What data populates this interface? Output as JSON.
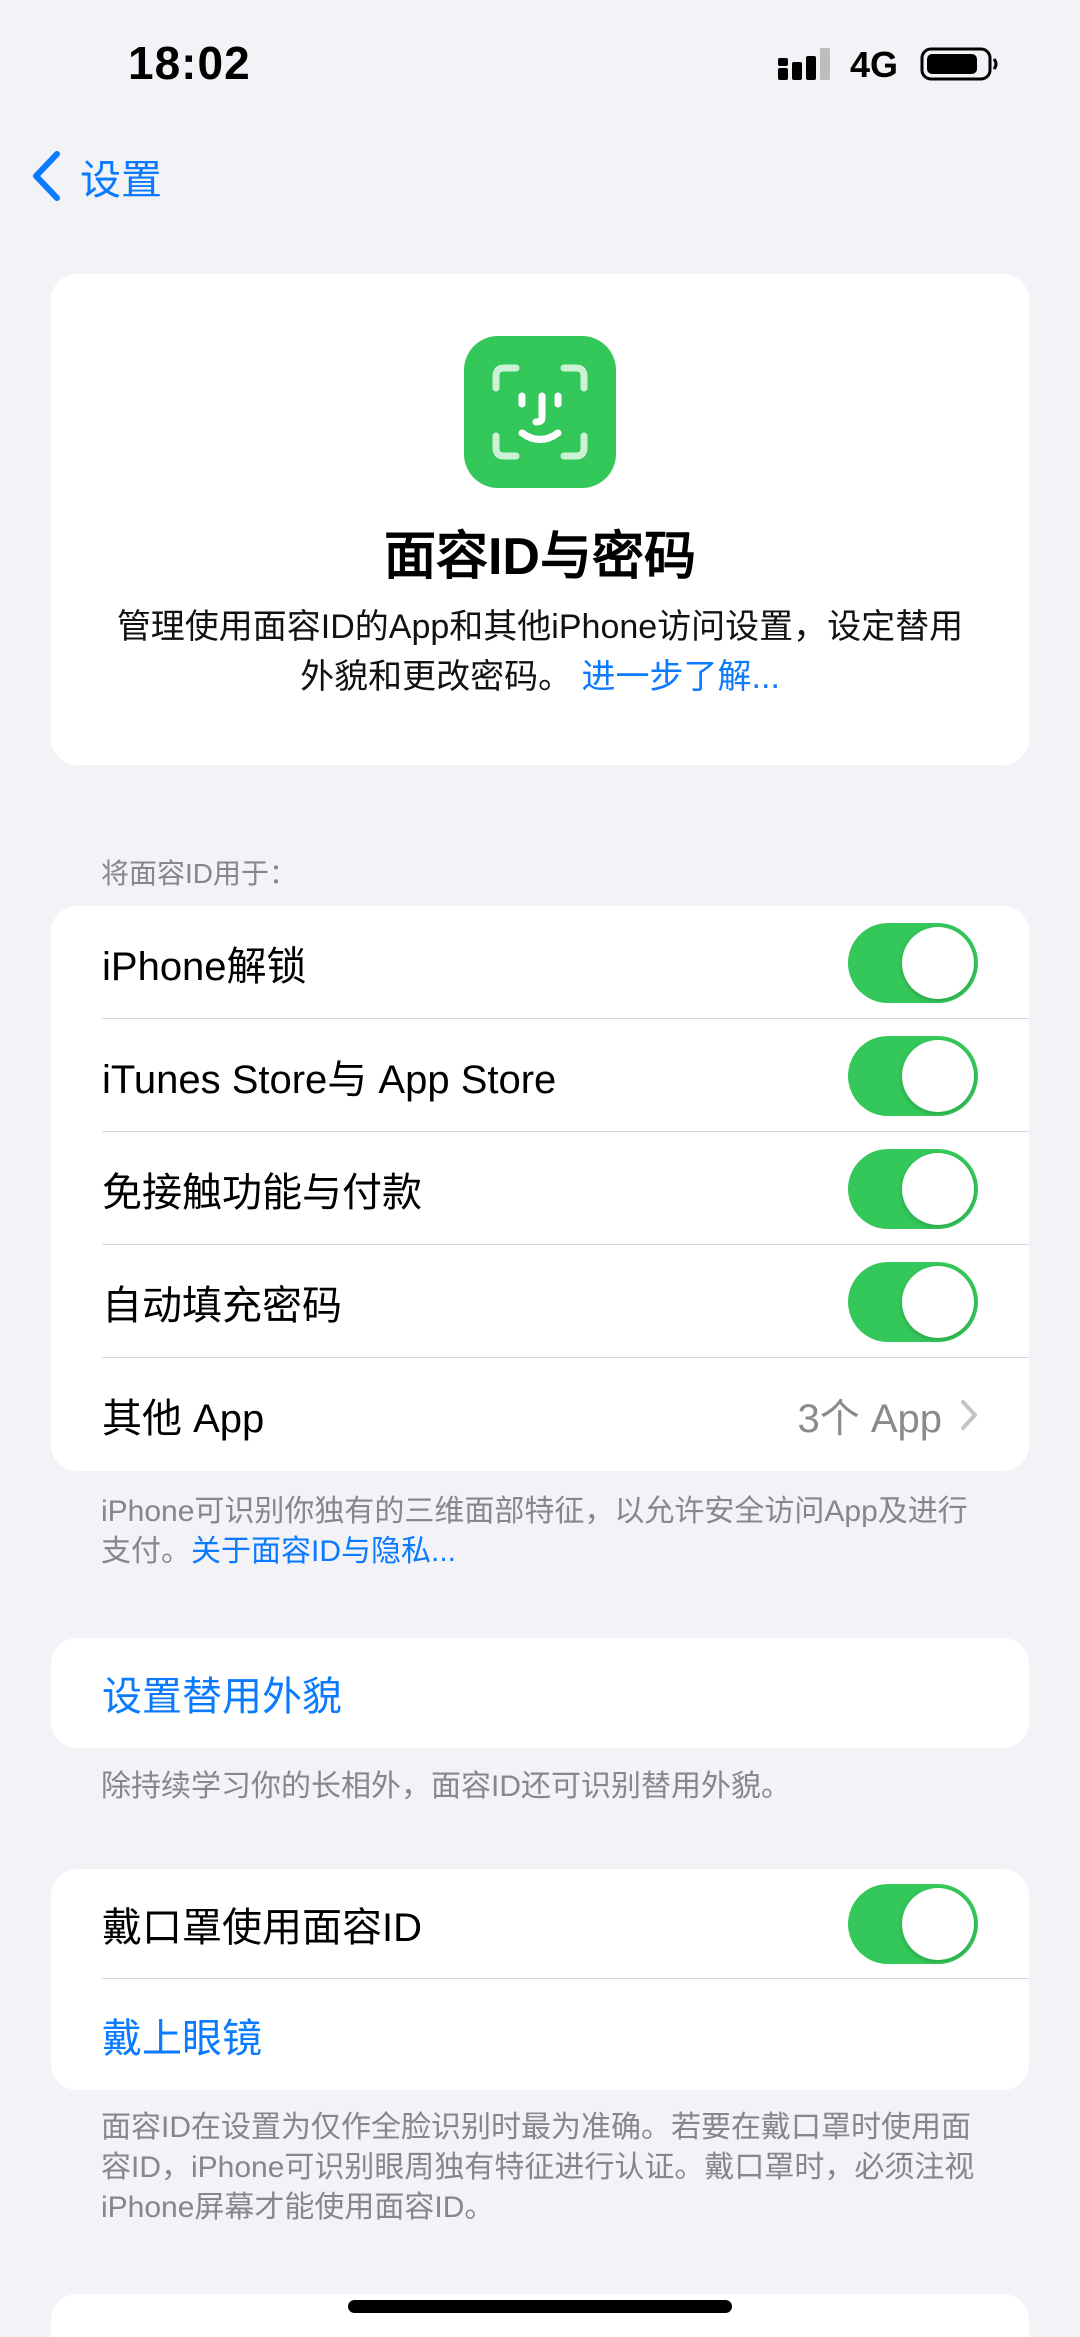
{
  "status": {
    "time": "18:02",
    "network": "4G"
  },
  "nav": {
    "back_label": "设置"
  },
  "header": {
    "title": "面容ID与密码",
    "description": "管理使用面容ID的App和其他iPhone访问设置，设定替用外貌和更改密码。",
    "learn_more": "进一步了解..."
  },
  "faceid_section": {
    "label": "将面容ID用于：",
    "rows": [
      {
        "label": "iPhone解锁",
        "toggle_on": true
      },
      {
        "label": "iTunes Store与 App Store",
        "toggle_on": true
      },
      {
        "label": "免接触功能与付款",
        "toggle_on": true
      },
      {
        "label": "自动填充密码",
        "toggle_on": true
      }
    ],
    "other_apps": {
      "label": "其他 App",
      "value": "3个 App"
    },
    "footnote": "iPhone可识别你独有的三维面部特征，以允许安全访问App及进行支付。",
    "footnote_link": "关于面容ID与隐私..."
  },
  "alternate": {
    "button": "设置替用外貌",
    "footnote": "除持续学习你的长相外，面容ID还可识别替用外貌。"
  },
  "mask": {
    "toggle_label": "戴口罩使用面容ID",
    "toggle_on": true,
    "glasses_button": "戴上眼镜",
    "footnote": "面容ID在设置为仅作全脸识别时最为准确。若要在戴口罩时使用面容ID，iPhone可识别眼周独有特征进行认证。戴口罩时，必须注视iPhone屏幕才能使用面容ID。"
  },
  "colors": {
    "accent": "#0a7aff",
    "toggle_on": "#34c759",
    "faceid_icon": "#34c759",
    "background": "#f2f2f7"
  }
}
